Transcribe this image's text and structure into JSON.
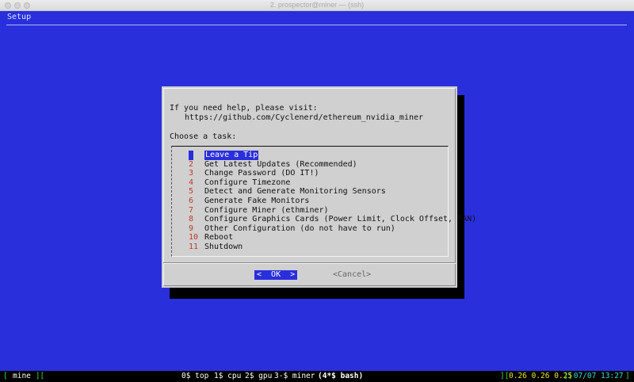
{
  "window": {
    "title": "2. prospector@miner — (ssh)"
  },
  "terminal": {
    "title": "Setup"
  },
  "dialog": {
    "help_line1": "If you need help, please visit:",
    "help_url": "https://github.com/Cyclenerd/ethereum_nvidia_miner",
    "prompt": "Choose a task:",
    "items": [
      {
        "num": "1",
        "label": "Leave a Tip"
      },
      {
        "num": "2",
        "label": "Get Latest Updates (Recommended)"
      },
      {
        "num": "3",
        "label": "Change Password (DO IT!)"
      },
      {
        "num": "4",
        "label": "Configure Timezone"
      },
      {
        "num": "5",
        "label": "Detect and Generate Monitoring Sensors"
      },
      {
        "num": "6",
        "label": "Generate Fake Monitors"
      },
      {
        "num": "7",
        "label": "Configure Miner (ethminer)"
      },
      {
        "num": "8",
        "label": "Configure Graphics Cards (Power Limit, Clock Offset, FAN)"
      },
      {
        "num": "9",
        "label": "Other Configuration (do not have to run)"
      },
      {
        "num": "10",
        "label": "Reboot"
      },
      {
        "num": "11",
        "label": "Shutdown"
      }
    ],
    "selected_index": 0,
    "ok_label": "<  OK  >",
    "cancel_label": "<Cancel>"
  },
  "statusbar": {
    "session_open": "[ ",
    "session": "mine",
    "session_close": " ][",
    "windows": [
      {
        "label": "0$ top"
      },
      {
        "label": "1$ cpu"
      },
      {
        "label": "2$ gpu"
      },
      {
        "label": "3-$ miner"
      },
      {
        "label": "(4*$ bash)"
      }
    ],
    "load_open": "][",
    "load": "0.26 0.26 0.25",
    "load_close": "][",
    "clock": " 07/07 13:27 ",
    "clock_close": "]"
  },
  "colors": {
    "terminal_bg": "#2a2fdc",
    "dialog_bg": "#d0d0d0",
    "number_red": "#c0392b",
    "status_green": "#3bd83b",
    "status_yellow": "#e6e62a",
    "status_cyan": "#3fd7d7"
  }
}
